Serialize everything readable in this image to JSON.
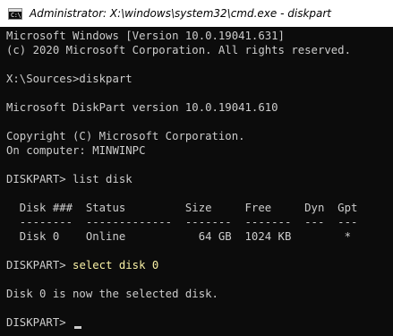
{
  "window": {
    "title": "Administrator: X:\\windows\\system32\\cmd.exe - diskpart",
    "icon": "cmd-icon",
    "icon_glyph": "C:\\"
  },
  "console": {
    "lines": [
      "Microsoft Windows [Version 10.0.19041.631]",
      "(c) 2020 Microsoft Corporation. All rights reserved.",
      "",
      "X:\\Sources>diskpart",
      "",
      "Microsoft DiskPart version 10.0.19041.610",
      "",
      "Copyright (C) Microsoft Corporation.",
      "On computer: MINWINPC",
      "",
      "DISKPART> list disk",
      "",
      "  Disk ###  Status         Size     Free     Dyn  Gpt",
      "  --------  -------------  -------  -------  ---  ---",
      "  Disk 0    Online           64 GB  1024 KB        *",
      "",
      "DISKPART> ",
      "",
      "Disk 0 is now the selected disk.",
      "",
      "DISKPART> "
    ],
    "highlighted_command": "select disk 0",
    "highlight_color": "#f9f1a5",
    "text_color": "#cccccc",
    "background_color": "#0c0c0c"
  }
}
